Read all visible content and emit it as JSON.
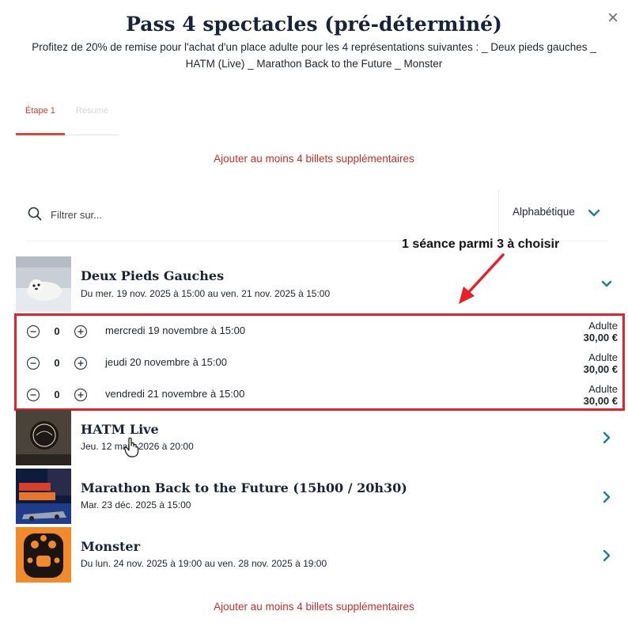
{
  "modal": {
    "title": "Pass 4 spectacles (pré-déterminé)",
    "description": "Profitez de 20% de remise pour l'achat d'un place adulte pour les 4 représentations suivantes : _ Deux pieds gauches _ HATM (Live) _ Marathon Back to the Future _ Monster",
    "close_icon": "×"
  },
  "steps": [
    {
      "label": "Étape 1",
      "active": true
    },
    {
      "label": "Résumé",
      "active": false
    }
  ],
  "notice": {
    "top": "Ajouter au moins 4 billets supplémentaires",
    "bottom": "Ajouter au moins 4 billets supplémentaires"
  },
  "filter": {
    "placeholder": "Filtrer sur...",
    "sort_label": "Alphabétique"
  },
  "annotation": "1 séance parmi 3 à choisir",
  "shows": [
    {
      "title": "Deux Pieds Gauches",
      "dates": "Du mer. 19 nov. 2025 à 15:00 au ven. 21 nov. 2025 à 15:00",
      "expanded": true,
      "sessions": [
        {
          "label": "mercredi 19 novembre à 15:00",
          "qty": "0",
          "price_type": "Adulte",
          "price": "30,00 €"
        },
        {
          "label": "jeudi 20 novembre à 15:00",
          "qty": "0",
          "price_type": "Adulte",
          "price": "30,00 €"
        },
        {
          "label": "vendredi 21 novembre à 15:00",
          "qty": "0",
          "price_type": "Adulte",
          "price": "30,00 €"
        }
      ]
    },
    {
      "title": "HATM Live",
      "dates": "Jeu. 12 mars 2026 à 20:00",
      "expanded": false
    },
    {
      "title": "Marathon Back to the Future (15h00 / 20h30)",
      "dates": "Mar. 23 déc. 2025 à 15:00",
      "expanded": false
    },
    {
      "title": "Monster",
      "dates": "Du lun. 24 nov. 2025 à 19:00 au ven. 28 nov. 2025 à 19:00",
      "expanded": false
    }
  ],
  "colors": {
    "accent": "#c0302a",
    "highlight_box": "#e8202a",
    "chevron": "#1a7f8e",
    "title": "#17223b"
  },
  "icons": [
    "close-icon",
    "search-icon",
    "chevron-down-icon",
    "chevron-right-icon",
    "minus-circle-icon",
    "plus-circle-icon",
    "arrow-annotation",
    "cursor-hand-icon"
  ]
}
